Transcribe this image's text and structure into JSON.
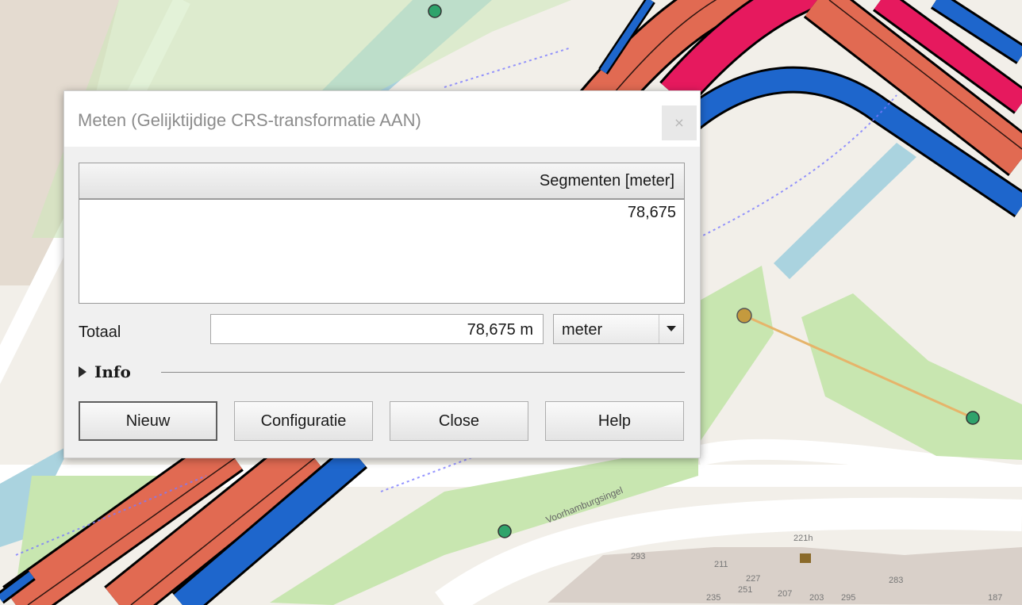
{
  "dialog": {
    "title": "Meten (Gelijktijdige CRS-transformatie AAN)",
    "close_glyph": "×",
    "table": {
      "header": "Segmenten [meter]",
      "rows": [
        "78,675"
      ]
    },
    "total": {
      "label": "Totaal",
      "value": "78,675 m",
      "unit": "meter"
    },
    "info_label": "Info",
    "buttons": {
      "new": "Nieuw",
      "config": "Configuratie",
      "close": "Close",
      "help": "Help"
    }
  },
  "map": {
    "street_label": "Voorhamburgsingel",
    "house_numbers": [
      "221h",
      "293",
      "211",
      "227",
      "251",
      "207",
      "203",
      "235",
      "187",
      "283",
      "295"
    ],
    "colors": {
      "background": "#f2efe9",
      "park": "#c8e6b0",
      "water": "#aad3df",
      "rail_red": "#e16a52",
      "rail_pink": "#e6195e",
      "rail_blue": "#1e66cc",
      "measure_line": "#e6b46a",
      "vertex_green": "#2fa36b"
    }
  }
}
